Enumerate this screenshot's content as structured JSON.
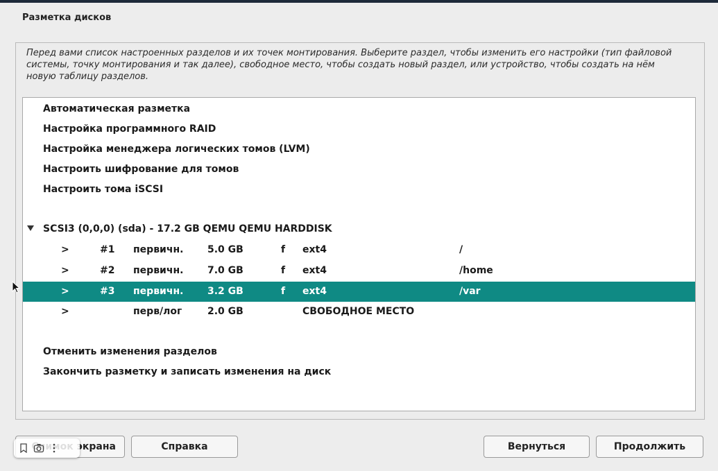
{
  "dialog": {
    "title": "Разметка дисков",
    "description": "Перед вами список настроенных разделов и их точек монтирования. Выберите раздел, чтобы изменить его настройки (тип файловой системы, точку монтирования и так далее), свободное место, чтобы создать новый раздел, или устройство, чтобы создать на нём новую таблицу разделов."
  },
  "actions": [
    "Автоматическая разметка",
    "Настройка программного RAID",
    "Настройка менеджера логических томов (LVM)",
    "Настроить шифрование для томов",
    "Настроить тома iSCSI"
  ],
  "disk": {
    "label": "SCSI3 (0,0,0) (sda) - 17.2 GB QEMU QEMU HARDDISK",
    "partitions": [
      {
        "arrow": ">",
        "num": "#1",
        "type": "первичн.",
        "size": "5.0 GB",
        "flag": "f",
        "fs": "ext4",
        "mount": "/"
      },
      {
        "arrow": ">",
        "num": "#2",
        "type": "первичн.",
        "size": "7.0 GB",
        "flag": "f",
        "fs": "ext4",
        "mount": "/home"
      },
      {
        "arrow": ">",
        "num": "#3",
        "type": "первичн.",
        "size": "3.2 GB",
        "flag": "f",
        "fs": "ext4",
        "mount": "/var"
      },
      {
        "arrow": ">",
        "num": "",
        "type": "перв/лог",
        "size": "2.0 GB",
        "flag": "",
        "fs": "СВОБОДНОЕ МЕСТО",
        "mount": ""
      }
    ]
  },
  "bottom_actions": [
    "Отменить изменения разделов",
    "Закончить разметку и записать изменения на диск"
  ],
  "buttons": {
    "screenshot": "Снимок экрана",
    "help": "Справка",
    "back": "Вернуться",
    "continue": "Продолжить"
  },
  "colors": {
    "selected_row": "#0f8a84"
  },
  "icons": [
    "bookmark-icon",
    "camera-icon",
    "more-vertical-icon",
    "mouse-pointer-icon",
    "expand-triangle-icon"
  ]
}
